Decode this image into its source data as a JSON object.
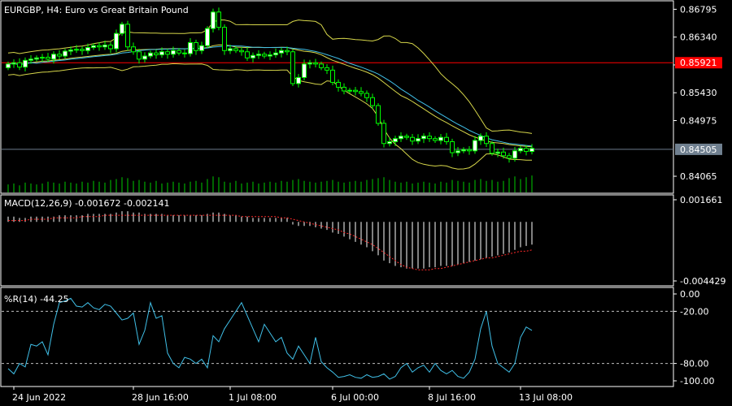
{
  "header": {
    "symbol": "EURGBP",
    "timeframe": "H4:",
    "description": "Euro vs Great Britain Pound"
  },
  "colors": {
    "background": "#000000",
    "frame": "#ffffff",
    "bull_candle": "#ffffff",
    "bear_candle": "#000000",
    "candle_outline": "#00ff00",
    "bands": "#d6d64a",
    "ma": "#40c0e8",
    "red_line": "#ff0000",
    "ask_line": "#6d7c8c",
    "ask_box": "#708090",
    "volume": "#00cc00",
    "macd_hist": "#ffffff",
    "macd_signal": "#ff2a2a",
    "wpr_line": "#40c0e8",
    "wpr_levels": "#c0c0c0"
  },
  "icons": {
    "pane_separator": "horizontal-rule"
  },
  "chart_data": [
    {
      "type": "candlestick",
      "pane": "main",
      "symbol": "EURGBP",
      "timeframe": "H4",
      "ylim": [
        0.838,
        0.8692
      ],
      "y_ticks": [
        "0.86795",
        "0.86340",
        "0.85885",
        "0.85430",
        "0.84975",
        "0.84505",
        "0.84065"
      ],
      "price_labels": {
        "red_level": {
          "label": "0.85921",
          "value": 0.85921
        },
        "current": {
          "label": "0.84505",
          "value": 0.84505
        }
      },
      "x_labels": [
        {
          "label": "24 Jun 2022",
          "index": 1
        },
        {
          "label": "28 Jun 16:00",
          "index": 22
        },
        {
          "label": "1 Jul 08:00",
          "index": 39
        },
        {
          "label": "6 Jul 00:00",
          "index": 57
        },
        {
          "label": "8 Jul 16:00",
          "index": 74
        },
        {
          "label": "13 Jul 08:00",
          "index": 90
        }
      ],
      "close": [
        0.859,
        0.8592,
        0.8585,
        0.8596,
        0.8598,
        0.86,
        0.8601,
        0.8598,
        0.8606,
        0.8603,
        0.8611,
        0.8613,
        0.8614,
        0.8612,
        0.8617,
        0.862,
        0.8618,
        0.8621,
        0.8615,
        0.864,
        0.8655,
        0.8618,
        0.861,
        0.8598,
        0.8603,
        0.8608,
        0.8605,
        0.861,
        0.8606,
        0.8612,
        0.8608,
        0.8607,
        0.8625,
        0.8612,
        0.862,
        0.8648,
        0.8675,
        0.865,
        0.8612,
        0.8615,
        0.8612,
        0.861,
        0.86,
        0.8604,
        0.8606,
        0.8603,
        0.8605,
        0.8608,
        0.8612,
        0.861,
        0.8558,
        0.8568,
        0.859,
        0.8592,
        0.859,
        0.8584,
        0.858,
        0.856,
        0.8552,
        0.8546,
        0.8547,
        0.8545,
        0.8542,
        0.8535,
        0.8522,
        0.8493,
        0.846,
        0.8463,
        0.8468,
        0.8472,
        0.847,
        0.8464,
        0.8468,
        0.8472,
        0.8468,
        0.8465,
        0.847,
        0.8463,
        0.8445,
        0.8448,
        0.845,
        0.8448,
        0.8465,
        0.8472,
        0.846,
        0.8444,
        0.8446,
        0.844,
        0.8436,
        0.8448,
        0.8452,
        0.8447,
        0.8452
      ],
      "volume": [
        0.45,
        0.5,
        0.4,
        0.55,
        0.5,
        0.45,
        0.5,
        0.6,
        0.55,
        0.5,
        0.6,
        0.55,
        0.5,
        0.6,
        0.55,
        0.65,
        0.6,
        0.55,
        0.7,
        0.75,
        0.85,
        0.8,
        0.65,
        0.7,
        0.6,
        0.55,
        0.65,
        0.5,
        0.55,
        0.6,
        0.55,
        0.5,
        0.6,
        0.65,
        0.55,
        0.75,
        0.9,
        0.85,
        0.6,
        0.55,
        0.65,
        0.5,
        0.55,
        0.6,
        0.5,
        0.55,
        0.6,
        0.55,
        0.65,
        0.6,
        0.7,
        0.75,
        0.65,
        0.6,
        0.55,
        0.6,
        0.65,
        0.7,
        0.6,
        0.55,
        0.6,
        0.65,
        0.6,
        0.7,
        0.75,
        0.8,
        0.85,
        0.7,
        0.6,
        0.55,
        0.6,
        0.5,
        0.55,
        0.6,
        0.55,
        0.5,
        0.6,
        0.55,
        0.7,
        0.65,
        0.6,
        0.55,
        0.7,
        0.75,
        0.65,
        0.7,
        0.6,
        0.65,
        0.8,
        0.9,
        0.75,
        0.85,
        0.95
      ]
    },
    {
      "type": "bar",
      "pane": "macd",
      "title": "MACD(12,26,9) -0.001672 -0.002141",
      "ylim": [
        -0.004429,
        0.001661
      ],
      "y_ticks": [
        "0.001661",
        "-0.004429"
      ],
      "histogram": [
        0.0004,
        0.0004,
        0.0003,
        0.0003,
        0.0004,
        0.0004,
        0.0004,
        0.0004,
        0.0004,
        0.0005,
        0.0005,
        0.0005,
        0.0005,
        0.0005,
        0.0006,
        0.0006,
        0.0006,
        0.0006,
        0.0006,
        0.0007,
        0.0008,
        0.0008,
        0.0007,
        0.0007,
        0.0006,
        0.0006,
        0.0006,
        0.0006,
        0.0005,
        0.0005,
        0.0005,
        0.0005,
        0.0005,
        0.0005,
        0.0005,
        0.0006,
        0.0007,
        0.0007,
        0.0006,
        0.0005,
        0.0005,
        0.0004,
        0.0004,
        0.0003,
        0.0003,
        0.0003,
        0.0003,
        0.0003,
        0.0003,
        0.0003,
        -0.0002,
        -0.0003,
        -0.0003,
        -0.0003,
        -0.0004,
        -0.0005,
        -0.0006,
        -0.0008,
        -0.0009,
        -0.0011,
        -0.0013,
        -0.0015,
        -0.0017,
        -0.0019,
        -0.0022,
        -0.0025,
        -0.0029,
        -0.0031,
        -0.0033,
        -0.0034,
        -0.0035,
        -0.0035,
        -0.0035,
        -0.0035,
        -0.0034,
        -0.0034,
        -0.0033,
        -0.0033,
        -0.0033,
        -0.0032,
        -0.0031,
        -0.003,
        -0.0029,
        -0.0028,
        -0.0027,
        -0.0026,
        -0.0025,
        -0.0024,
        -0.0023,
        -0.0021,
        -0.0019,
        -0.0018,
        -0.0017
      ],
      "signal": [
        0.0001,
        0.0001,
        0.0001,
        0.0001,
        0.0002,
        0.0002,
        0.0002,
        0.0002,
        0.0003,
        0.0003,
        0.0003,
        0.0003,
        0.0003,
        0.0004,
        0.0004,
        0.0004,
        0.0004,
        0.0005,
        0.0005,
        0.0005,
        0.0005,
        0.0005,
        0.0005,
        0.0005,
        0.0005,
        0.0005,
        0.0005,
        0.0005,
        0.0005,
        0.0005,
        0.0005,
        0.0005,
        0.0005,
        0.0005,
        0.0005,
        0.0005,
        0.0005,
        0.0005,
        0.0005,
        0.0005,
        0.0005,
        0.0004,
        0.0004,
        0.0004,
        0.0004,
        0.0004,
        0.0004,
        0.0004,
        0.0003,
        0.0003,
        0.0002,
        0.0001,
        0.0,
        -0.0001,
        -0.0002,
        -0.0003,
        -0.0004,
        -0.0005,
        -0.0006,
        -0.0008,
        -0.0009,
        -0.0011,
        -0.0013,
        -0.0015,
        -0.0017,
        -0.002,
        -0.0023,
        -0.0026,
        -0.0029,
        -0.0032,
        -0.0034,
        -0.0035,
        -0.0036,
        -0.0036,
        -0.0036,
        -0.0035,
        -0.0035,
        -0.0034,
        -0.0033,
        -0.0032,
        -0.0031,
        -0.003,
        -0.0029,
        -0.0028,
        -0.0027,
        -0.0027,
        -0.0026,
        -0.0025,
        -0.0024,
        -0.0023,
        -0.0022,
        -0.0022,
        -0.0021
      ]
    },
    {
      "type": "line",
      "pane": "wpr",
      "title": "%R(14) -44.25",
      "ylim": [
        -100,
        0
      ],
      "y_ticks": [
        "0.00",
        "-20.00",
        "-80.00",
        "-100.00"
      ],
      "levels": [
        -20,
        -80
      ],
      "values": [
        -86,
        -92,
        -80,
        -84,
        -58,
        -60,
        -55,
        -70,
        -35,
        -10,
        -8,
        -5,
        -14,
        -15,
        -10,
        -16,
        -18,
        -12,
        -14,
        -22,
        -30,
        -28,
        -22,
        -58,
        -42,
        -10,
        -28,
        -25,
        -68,
        -80,
        -85,
        -73,
        -75,
        -80,
        -75,
        -85,
        -48,
        -55,
        -40,
        -30,
        -20,
        -10,
        -25,
        -40,
        -55,
        -35,
        -45,
        -55,
        -50,
        -68,
        -75,
        -60,
        -70,
        -80,
        -50,
        -78,
        -85,
        -90,
        -96,
        -95,
        -93,
        -96,
        -97,
        -93,
        -96,
        -95,
        -92,
        -98,
        -95,
        -85,
        -80,
        -90,
        -85,
        -82,
        -90,
        -80,
        -88,
        -92,
        -88,
        -95,
        -97,
        -90,
        -75,
        -40,
        -20,
        -60,
        -80,
        -85,
        -90,
        -80,
        -50,
        -38,
        -42
      ]
    }
  ]
}
